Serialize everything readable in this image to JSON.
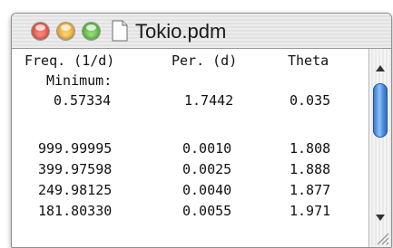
{
  "window": {
    "title": "Tokio.pdm",
    "colors": {
      "close": "#d23a2a",
      "minimize": "#e29a10",
      "zoom": "#3aa02a",
      "scroll_thumb": "#4a8ddd"
    }
  },
  "table": {
    "headers": {
      "freq": "Freq. (1/d)",
      "period": "Per. (d)",
      "theta": "Theta"
    },
    "minimum_label": "Minimum:",
    "minimum": {
      "freq": "0.57334",
      "period": "1.7442",
      "theta": "0.035"
    },
    "rows": [
      {
        "freq": "999.99995",
        "period": "0.0010",
        "theta": "1.808"
      },
      {
        "freq": "399.97598",
        "period": "0.0025",
        "theta": "1.888"
      },
      {
        "freq": "249.98125",
        "period": "0.0040",
        "theta": "1.877"
      },
      {
        "freq": "181.80330",
        "period": "0.0055",
        "theta": "1.971"
      }
    ]
  },
  "icons": [
    "close-light-icon",
    "minimize-light-icon",
    "zoom-light-icon",
    "document-icon",
    "scroll-up-arrow-icon",
    "scroll-down-arrow-icon",
    "resize-grip-icon"
  ]
}
